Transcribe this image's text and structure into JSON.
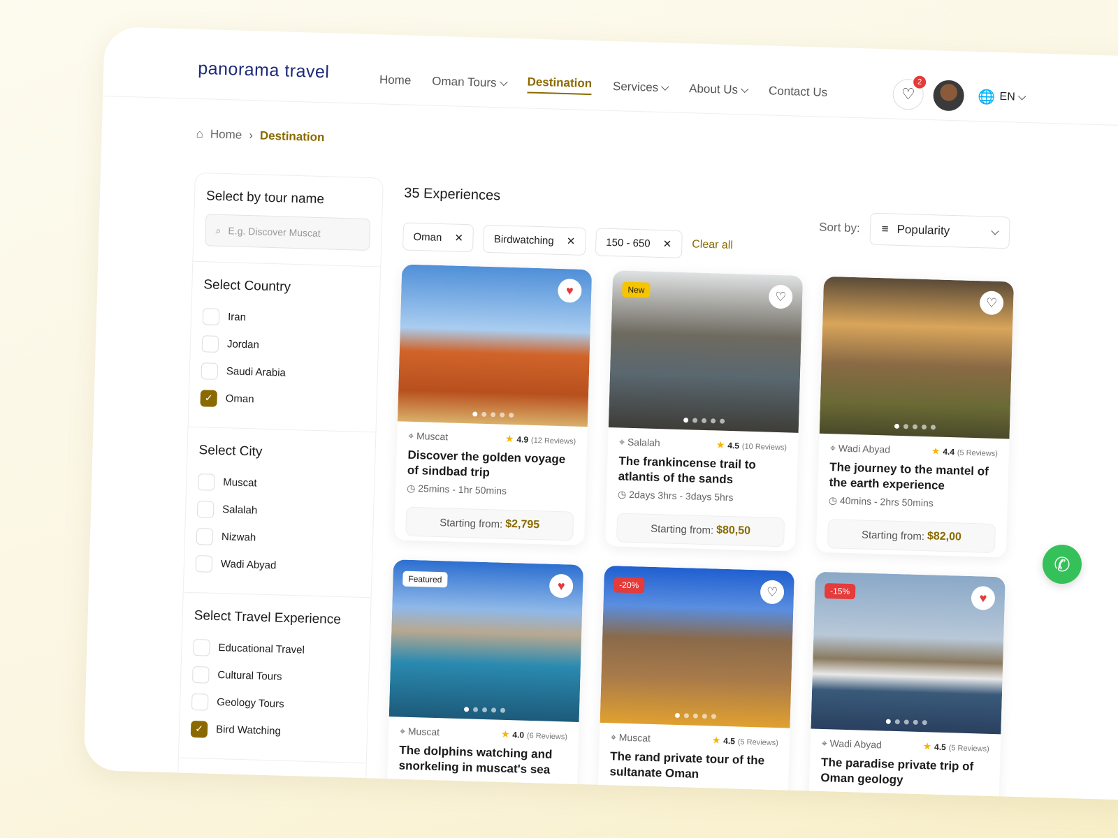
{
  "brand": "panorama travel",
  "nav": [
    {
      "label": "Home"
    },
    {
      "label": "Oman Tours",
      "dropdown": true
    },
    {
      "label": "Destination",
      "active": true
    },
    {
      "label": "Services",
      "dropdown": true
    },
    {
      "label": "About Us",
      "dropdown": true
    },
    {
      "label": "Contact Us"
    }
  ],
  "header": {
    "wishlist_count": "2",
    "language": "EN"
  },
  "breadcrumb": {
    "home": "Home",
    "current": "Destination"
  },
  "sidebar": {
    "tour_name": {
      "title": "Select by tour name",
      "placeholder": "E.g. Discover Muscat"
    },
    "country": {
      "title": "Select Country",
      "items": [
        {
          "label": "Iran",
          "checked": false
        },
        {
          "label": "Jordan",
          "checked": false
        },
        {
          "label": "Saudi Arabia",
          "checked": false
        },
        {
          "label": "Oman",
          "checked": true
        }
      ]
    },
    "city": {
      "title": "Select City",
      "items": [
        {
          "label": "Muscat",
          "checked": false
        },
        {
          "label": "Salalah",
          "checked": false
        },
        {
          "label": "Nizwah",
          "checked": false
        },
        {
          "label": "Wadi Abyad",
          "checked": false
        }
      ]
    },
    "experience": {
      "title": "Select Travel Experience",
      "items": [
        {
          "label": "Educational Travel",
          "checked": false
        },
        {
          "label": "Cultural Tours",
          "checked": false
        },
        {
          "label": "Geology Tours",
          "checked": false
        },
        {
          "label": "Bird Watching",
          "checked": true
        }
      ]
    },
    "price": {
      "title": "Price Range (USD)"
    }
  },
  "main": {
    "count": "35 Experiences",
    "sort_label": "Sort by:",
    "sort_value": "Popularity",
    "chips": [
      "Oman",
      "Birdwatching",
      "150 - 650"
    ],
    "clear": "Clear all",
    "price_prefix": "Starting from:",
    "cards": [
      {
        "location": "Muscat",
        "rating": "4.9",
        "reviews": "(12 Reviews)",
        "title": "Discover the golden voyage of sindbad trip",
        "duration": "25mins - 1hr 50mins",
        "price": "$2,795",
        "fav": true,
        "tag": "",
        "bg": "linear-gradient(#4f8fd8,#a9cdf0 40%,#d0642a 55%,#b8501e 80%,#d9b06a)"
      },
      {
        "location": "Salalah",
        "rating": "4.5",
        "reviews": "(10 Reviews)",
        "title": "The frankincense trail to atlantis of the sands",
        "duration": "2days 3hrs - 3days 5hrs",
        "price": "$80,50",
        "fav": false,
        "tag": "New",
        "bg": "linear-gradient(#dfe2e3,#6e6a60 40%,#5a6870 65%,#3e3d38)"
      },
      {
        "location": "Wadi Abyad",
        "rating": "4.4",
        "reviews": "(5 Reviews)",
        "title": "The journey to the mantel of the earth experience",
        "duration": "40mins - 2hrs 50mins",
        "price": "$82,00",
        "fav": false,
        "tag": "",
        "bg": "linear-gradient(#5a4a38,#d9a55a 30%,#8a6a45 55%,#6a6a35 80%,#4a4a2a)"
      },
      {
        "location": "Muscat",
        "rating": "4.0",
        "reviews": "(6 Reviews)",
        "title": "The dolphins watching and snorkeling in muscat's sea",
        "duration": "",
        "price": "",
        "fav": true,
        "tag": "Featured",
        "bg": "linear-gradient(#2c6fd0,#8fb8e8 30%,#b8a890 45%,#2a8ab0 65%,#1d5a7a)"
      },
      {
        "location": "Muscat",
        "rating": "4.5",
        "reviews": "(5 Reviews)",
        "title": "The rand private tour of the sultanate Oman",
        "duration": "",
        "price": "",
        "fav": false,
        "tag": "-20%",
        "bg": "linear-gradient(#1f5fd0,#5a8ee0 25%,#8a6a4a 45%,#a87a4a 70%,#e0a030)"
      },
      {
        "location": "Wadi Abyad",
        "rating": "4.5",
        "reviews": "(5 Reviews)",
        "title": "The paradise private trip of Oman geology",
        "duration": "",
        "price": "",
        "fav": true,
        "tag": "-15%",
        "bg": "linear-gradient(#8aa8c8,#b8c8d8 40%,#8a7a60 55%,#e8e8e8 65%,#3a5a7a 75%,#2a4060)"
      }
    ]
  },
  "colors": {
    "accent": "#8a6a00",
    "brand": "#1d2a7a",
    "whatsapp": "#35c15a"
  }
}
